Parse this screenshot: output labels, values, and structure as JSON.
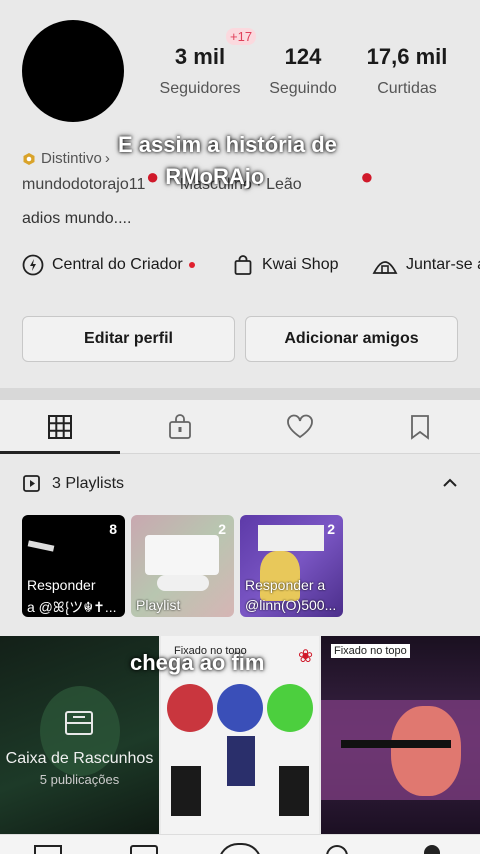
{
  "profile": {
    "follower_badge": "+17",
    "stats": [
      {
        "value": "3 mil",
        "label": "Seguidores"
      },
      {
        "value": "124",
        "label": "Seguindo"
      },
      {
        "value": "17,6 mil",
        "label": "Curtidas"
      }
    ],
    "distinction": "Distintivo",
    "username_line": "mundodotorajo11",
    "gender_line": "Masculino · Leão",
    "bio": "adios mundo...."
  },
  "overlay": {
    "line1": "E assim a história de",
    "line2": "RMoRAjo",
    "bottom": "chega ao fim"
  },
  "links": {
    "creator": "Central do Criador",
    "shop": "Kwai Shop",
    "join": "Juntar-se a"
  },
  "buttons": {
    "edit": "Editar perfil",
    "add": "Adicionar amigos"
  },
  "playlists": {
    "header": "3 Playlists",
    "items": [
      {
        "count": "8",
        "line1": "Responder",
        "line2": "a @ꕤ⁅ツ☬✝..."
      },
      {
        "count": "2",
        "line1": "",
        "line2": "Playlist"
      },
      {
        "count": "2",
        "line1": "Responder a",
        "line2": "@linn(O)500..."
      }
    ]
  },
  "grid": {
    "drafts_title": "Caixa de Rascunhos",
    "drafts_sub": "5 publicações",
    "pinned1": "Fixado no topo",
    "pinned2": "Fixado no topo"
  },
  "colors": {
    "accent_red": "#e0405a",
    "creator_dot": "#e0202e"
  }
}
